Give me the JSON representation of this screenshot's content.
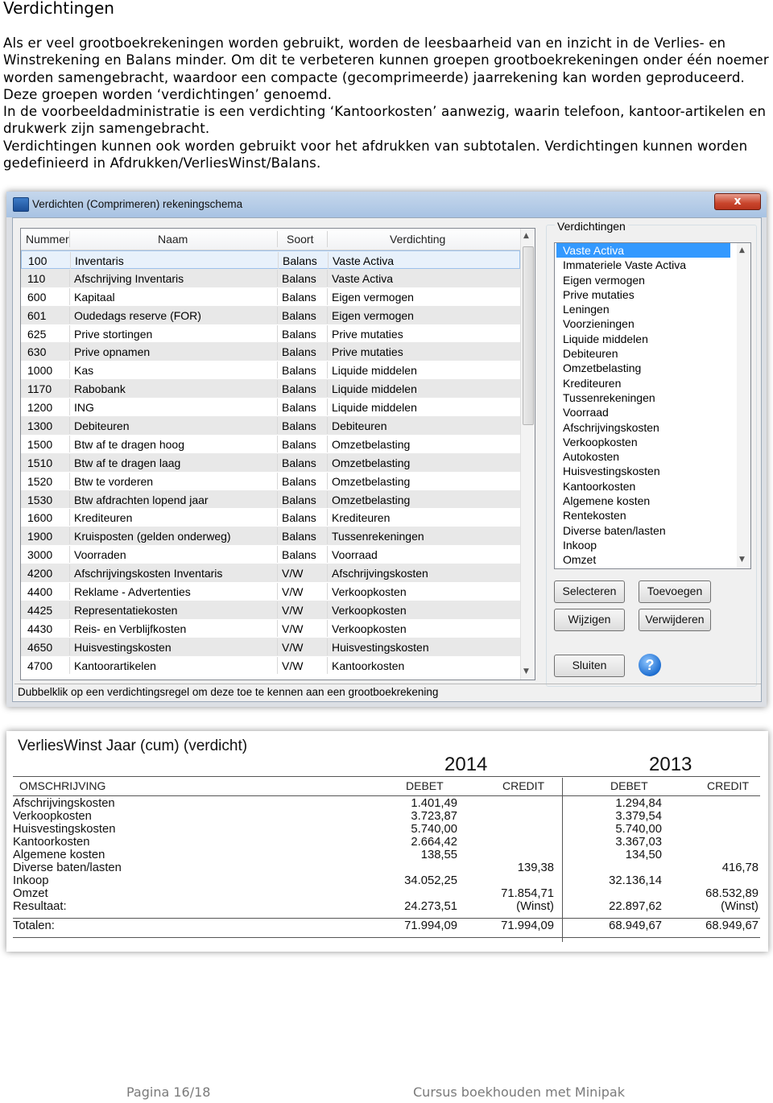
{
  "heading": "Verdichtingen",
  "intro": [
    "Als er veel grootboekrekeningen worden gebruikt, worden de leesbaarheid van en inzicht in de Verlies- en Winstrekening en Balans minder. Om dit te verbeteren kunnen groepen grootboekrekeningen onder één noemer worden samengebracht, waardoor een compacte (gecomprimeerde) jaarrekening kan worden geproduceerd. Deze groepen worden ‘verdichtingen’ genoemd.",
    "In de voorbeeldadministratie is een verdichting ‘Kantoorkosten’ aanwezig, waarin telefoon, kantoor-artikelen en drukwerk zijn samengebracht.",
    "Verdichtingen kunnen ook worden gebruikt voor het afdrukken van subtotalen. Verdichtingen kunnen worden gedefinieerd in Afdrukken/VerliesWinst/Balans."
  ],
  "window": {
    "title": "Verdichten (Comprimeren) rekeningschema",
    "close": "x",
    "grid": {
      "columns": [
        "Nummer",
        "Naam",
        "Soort",
        "Verdichting"
      ],
      "rows": [
        [
          "100",
          "Inventaris",
          "Balans",
          "Vaste Activa"
        ],
        [
          "110",
          "Afschrijving Inventaris",
          "Balans",
          "Vaste Activa"
        ],
        [
          "600",
          "Kapitaal",
          "Balans",
          "Eigen vermogen"
        ],
        [
          "601",
          "Oudedags reserve (FOR)",
          "Balans",
          "Eigen vermogen"
        ],
        [
          "625",
          "Prive stortingen",
          "Balans",
          "Prive mutaties"
        ],
        [
          "630",
          "Prive opnamen",
          "Balans",
          "Prive mutaties"
        ],
        [
          "1000",
          "Kas",
          "Balans",
          "Liquide middelen"
        ],
        [
          "1170",
          "Rabobank",
          "Balans",
          "Liquide middelen"
        ],
        [
          "1200",
          "ING",
          "Balans",
          "Liquide middelen"
        ],
        [
          "1300",
          "Debiteuren",
          "Balans",
          "Debiteuren"
        ],
        [
          "1500",
          "Btw af te dragen hoog",
          "Balans",
          "Omzetbelasting"
        ],
        [
          "1510",
          "Btw af te dragen laag",
          "Balans",
          "Omzetbelasting"
        ],
        [
          "1520",
          "Btw te vorderen",
          "Balans",
          "Omzetbelasting"
        ],
        [
          "1530",
          "Btw afdrachten lopend jaar",
          "Balans",
          "Omzetbelasting"
        ],
        [
          "1600",
          "Krediteuren",
          "Balans",
          "Krediteuren"
        ],
        [
          "1900",
          "Kruisposten (gelden onderweg)",
          "Balans",
          "Tussenrekeningen"
        ],
        [
          "3000",
          "Voorraden",
          "Balans",
          "Voorraad"
        ],
        [
          "4200",
          "Afschrijvingskosten Inventaris",
          "V/W",
          "Afschrijvingskosten"
        ],
        [
          "4400",
          "Reklame - Advertenties",
          "V/W",
          "Verkoopkosten"
        ],
        [
          "4425",
          "Representatiekosten",
          "V/W",
          "Verkoopkosten"
        ],
        [
          "4430",
          "Reis- en Verblijfkosten",
          "V/W",
          "Verkoopkosten"
        ],
        [
          "4650",
          "Huisvestingskosten",
          "V/W",
          "Huisvestingskosten"
        ],
        [
          "4700",
          "Kantoorartikelen",
          "V/W",
          "Kantoorkosten"
        ]
      ]
    },
    "verdichtingen": {
      "label": "Verdichtingen",
      "items": [
        "Vaste Activa",
        "Immateriele Vaste Activa",
        "Eigen vermogen",
        "Prive mutaties",
        "Leningen",
        "Voorzieningen",
        "Liquide middelen",
        "Debiteuren",
        "Omzetbelasting",
        "Krediteuren",
        "Tussenrekeningen",
        "Voorraad",
        "Afschrijvingskosten",
        "Verkoopkosten",
        "Autokosten",
        "Huisvestingskosten",
        "Kantoorkosten",
        "Algemene kosten",
        "Rentekosten",
        "Diverse baten/lasten",
        "Inkoop",
        "Omzet"
      ],
      "selected": "Vaste Activa"
    },
    "buttons": {
      "selecteren": "Selecteren",
      "toevoegen": "Toevoegen",
      "wijzigen": "Wijzigen",
      "verwijderen": "Verwijderen",
      "sluiten": "Sluiten",
      "help": "?"
    },
    "status": "Dubbelklik op een verdichtingsregel om deze toe te kennen aan een grootboekrekening"
  },
  "report": {
    "title": "VerliesWinst Jaar  (cum) (verdicht)",
    "years": [
      "2014",
      "2013"
    ],
    "col_omschrijving": "OMSCHRIJVING",
    "col_debet": "DEBET",
    "col_credit": "CREDIT",
    "rows": [
      {
        "label": "Afschrijvingskosten",
        "d1": "1.401,49",
        "c1": "",
        "d2": "1.294,84",
        "c2": ""
      },
      {
        "label": "Verkoopkosten",
        "d1": "3.723,87",
        "c1": "",
        "d2": "3.379,54",
        "c2": ""
      },
      {
        "label": "Huisvestingskosten",
        "d1": "5.740,00",
        "c1": "",
        "d2": "5.740,00",
        "c2": ""
      },
      {
        "label": "Kantoorkosten",
        "d1": "2.664,42",
        "c1": "",
        "d2": "3.367,03",
        "c2": ""
      },
      {
        "label": "Algemene kosten",
        "d1": "138,55",
        "c1": "",
        "d2": "134,50",
        "c2": ""
      },
      {
        "label": "Diverse baten/lasten",
        "d1": "",
        "c1": "139,38",
        "d2": "",
        "c2": "416,78"
      },
      {
        "label": "Inkoop",
        "d1": "34.052,25",
        "c1": "",
        "d2": "32.136,14",
        "c2": ""
      },
      {
        "label": "Omzet",
        "d1": "",
        "c1": "71.854,71",
        "d2": "",
        "c2": "68.532,89"
      },
      {
        "label": "Resultaat:",
        "d1": "24.273,51",
        "c1": "(Winst)",
        "d2": "22.897,62",
        "c2": "(Winst)"
      }
    ],
    "totals": {
      "label": "Totalen:",
      "d1": "71.994,09",
      "c1": "71.994,09",
      "d2": "68.949,67",
      "c2": "68.949,67"
    }
  },
  "footer": {
    "page": "Pagina 16/18",
    "course": "Cursus boekhouden met Minipak"
  }
}
